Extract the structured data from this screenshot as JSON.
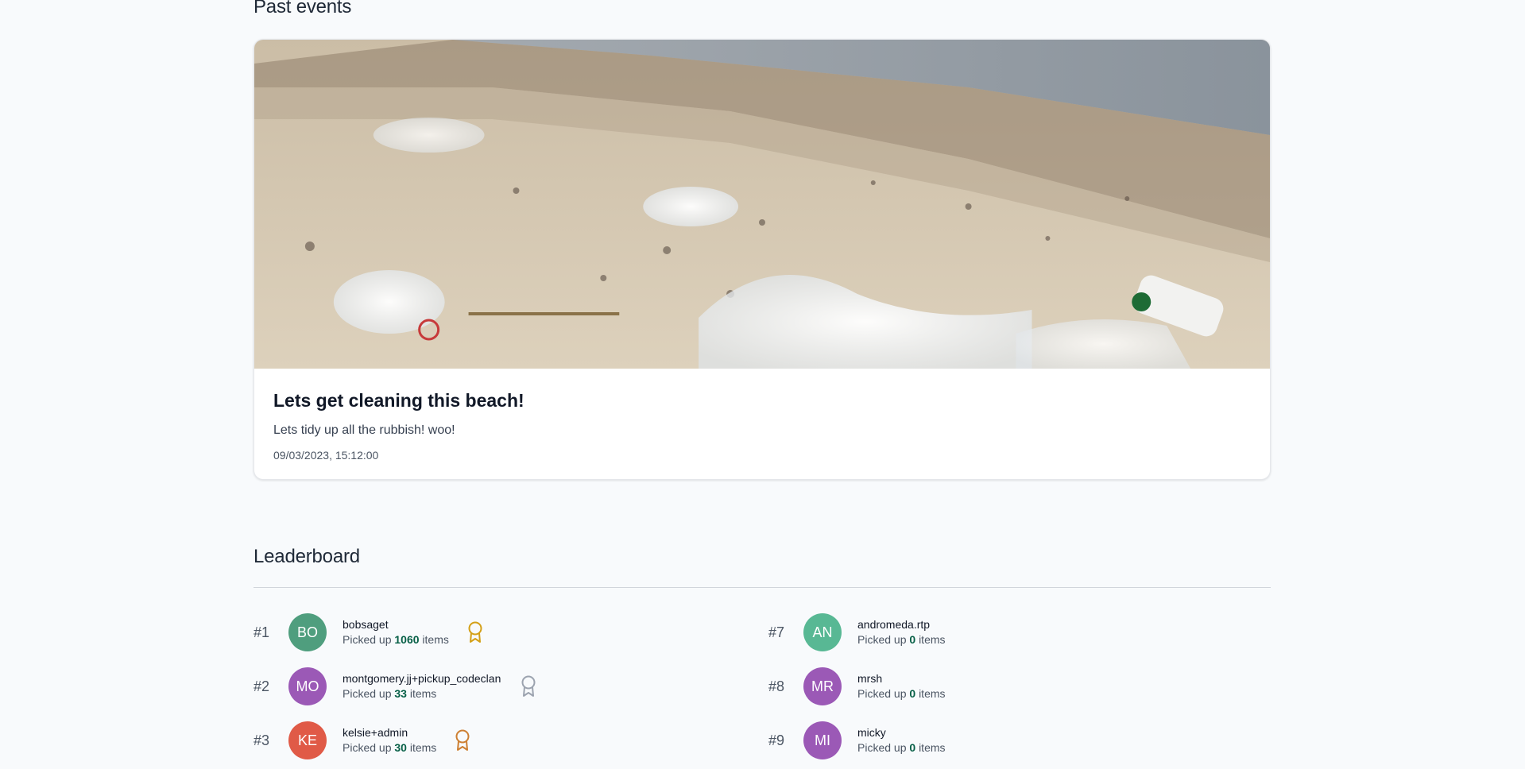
{
  "past_events": {
    "title": "Past events",
    "events": [
      {
        "title": "Lets get cleaning this beach!",
        "description": "Lets tidy up all the rubbish! woo!",
        "date": "09/03/2023, 15:12:00"
      }
    ]
  },
  "leaderboard": {
    "title": "Leaderboard",
    "picked_prefix": "Picked up",
    "picked_suffix": "items",
    "entries": [
      {
        "rank": "#1",
        "initials": "BO",
        "name": "bobsaget",
        "count": "1060",
        "avatar_color": "#4f9e7e",
        "medal": "gold"
      },
      {
        "rank": "#2",
        "initials": "MO",
        "name": "montgomery.jj+pickup_codeclan",
        "count": "33",
        "avatar_color": "#9b59b6",
        "medal": "silver"
      },
      {
        "rank": "#3",
        "initials": "KE",
        "name": "kelsie+admin",
        "count": "30",
        "avatar_color": "#e05a47",
        "medal": "bronze"
      },
      {
        "rank": "#7",
        "initials": "AN",
        "name": "andromeda.rtp",
        "count": "0",
        "avatar_color": "#58b894",
        "medal": ""
      },
      {
        "rank": "#8",
        "initials": "MR",
        "name": "mrsh",
        "count": "0",
        "avatar_color": "#9b59b6",
        "medal": ""
      },
      {
        "rank": "#9",
        "initials": "MI",
        "name": "micky",
        "count": "0",
        "avatar_color": "#9b59b6",
        "medal": ""
      }
    ]
  },
  "colors": {
    "gold": "#d4a017",
    "silver": "#9ca3af",
    "bronze": "#cd7f32"
  }
}
